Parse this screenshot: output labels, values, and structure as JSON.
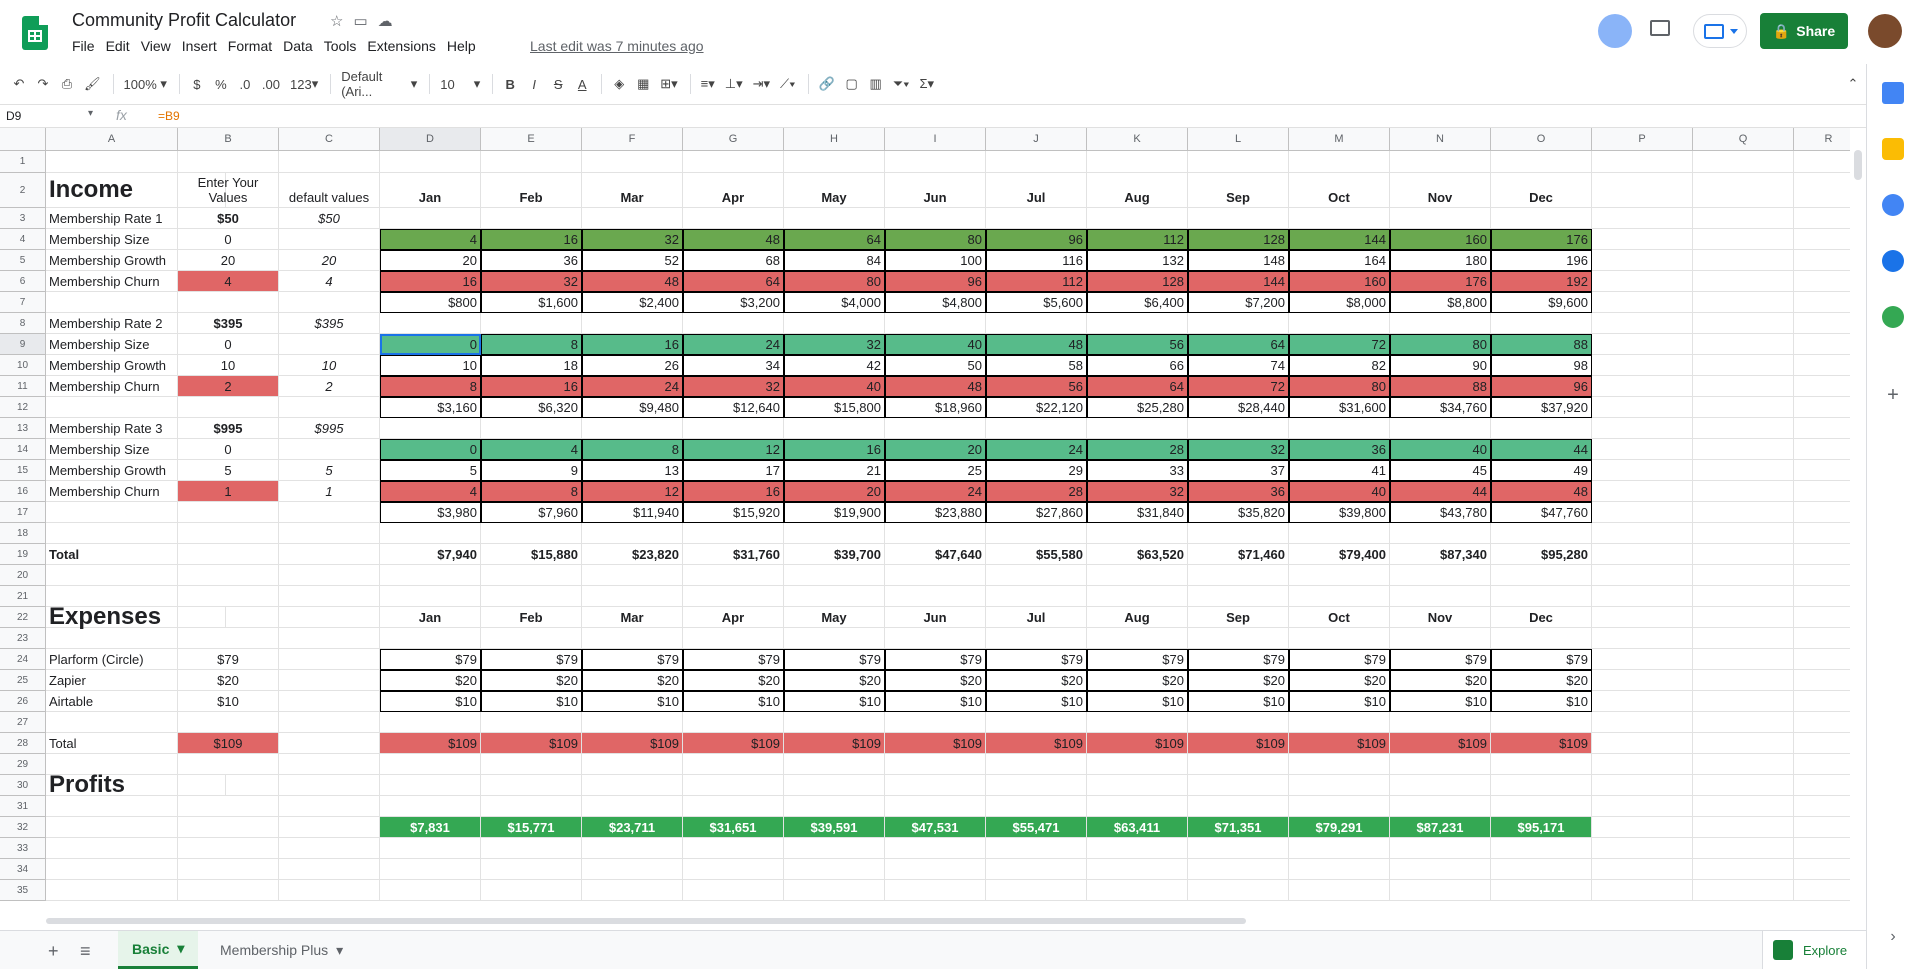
{
  "doc": {
    "title": "Community Profit Calculator",
    "last_edit": "Last edit was 7 minutes ago",
    "share": "Share"
  },
  "menu": [
    "File",
    "Edit",
    "View",
    "Insert",
    "Format",
    "Data",
    "Tools",
    "Extensions",
    "Help"
  ],
  "toolbar": {
    "zoom": "100%",
    "currency": "$",
    "percent": "%",
    "dec_less": ".0",
    "dec_more": ".00",
    "format": "123",
    "font": "Default (Ari...",
    "size": "10",
    "bold": "B",
    "italic": "I",
    "strike": "S",
    "color": "A"
  },
  "formula": {
    "cell": "D9",
    "fx": "fx",
    "value": "=B9"
  },
  "columns": [
    "A",
    "B",
    "C",
    "D",
    "E",
    "F",
    "G",
    "H",
    "I",
    "J",
    "K",
    "L",
    "M",
    "N",
    "O",
    "P",
    "Q",
    "R"
  ],
  "rows": [
    "1",
    "2",
    "3",
    "4",
    "5",
    "6",
    "7",
    "8",
    "9",
    "10",
    "11",
    "12",
    "13",
    "14",
    "15",
    "16",
    "17",
    "18",
    "19",
    "20",
    "21",
    "22",
    "23",
    "24",
    "25",
    "26",
    "27",
    "28",
    "29",
    "30",
    "31",
    "32",
    "33",
    "34",
    "35"
  ],
  "labels": {
    "income": "Income",
    "enter": "Enter Your Values",
    "default": "default values",
    "expenses": "Expenses",
    "profits": "Profits",
    "total": "Total",
    "rate1": "Membership Rate 1",
    "rate2": "Membership Rate 2",
    "rate3": "Membership Rate 3",
    "size": "Membership Size",
    "growth": "Membership Growth",
    "churn": "Membership Churn",
    "plat": "Plarform (Circle)",
    "zapier": "Zapier",
    "airtable": "Airtable"
  },
  "months": [
    "Jan",
    "Feb",
    "Mar",
    "Apr",
    "May",
    "Jun",
    "Jul",
    "Aug",
    "Sep",
    "Oct",
    "Nov",
    "Dec"
  ],
  "inputs": {
    "r1": {
      "rate": "$50",
      "rate_d": "$50",
      "size": "0",
      "growth": "20",
      "growth_d": "20",
      "churn": "4",
      "churn_d": "4"
    },
    "r2": {
      "rate": "$395",
      "rate_d": "$395",
      "size": "0",
      "growth": "10",
      "growth_d": "10",
      "churn": "2",
      "churn_d": "2"
    },
    "r3": {
      "rate": "$995",
      "rate_d": "$995",
      "size": "0",
      "growth": "5",
      "growth_d": "5",
      "churn": "1",
      "churn_d": "1"
    }
  },
  "grid": {
    "r4": [
      "4",
      "16",
      "32",
      "48",
      "64",
      "80",
      "96",
      "112",
      "128",
      "144",
      "160",
      "176"
    ],
    "r5": [
      "20",
      "36",
      "52",
      "68",
      "84",
      "100",
      "116",
      "132",
      "148",
      "164",
      "180",
      "196"
    ],
    "r6": [
      "16",
      "32",
      "48",
      "64",
      "80",
      "96",
      "112",
      "128",
      "144",
      "160",
      "176",
      "192"
    ],
    "r7": [
      "$800",
      "$1,600",
      "$2,400",
      "$3,200",
      "$4,000",
      "$4,800",
      "$5,600",
      "$6,400",
      "$7,200",
      "$8,000",
      "$8,800",
      "$9,600"
    ],
    "r9": [
      "0",
      "8",
      "16",
      "24",
      "32",
      "40",
      "48",
      "56",
      "64",
      "72",
      "80",
      "88"
    ],
    "r10": [
      "10",
      "18",
      "26",
      "34",
      "42",
      "50",
      "58",
      "66",
      "74",
      "82",
      "90",
      "98"
    ],
    "r11": [
      "8",
      "16",
      "24",
      "32",
      "40",
      "48",
      "56",
      "64",
      "72",
      "80",
      "88",
      "96"
    ],
    "r12": [
      "$3,160",
      "$6,320",
      "$9,480",
      "$12,640",
      "$15,800",
      "$18,960",
      "$22,120",
      "$25,280",
      "$28,440",
      "$31,600",
      "$34,760",
      "$37,920"
    ],
    "r14": [
      "0",
      "4",
      "8",
      "12",
      "16",
      "20",
      "24",
      "28",
      "32",
      "36",
      "40",
      "44"
    ],
    "r15": [
      "5",
      "9",
      "13",
      "17",
      "21",
      "25",
      "29",
      "33",
      "37",
      "41",
      "45",
      "49"
    ],
    "r16": [
      "4",
      "8",
      "12",
      "16",
      "20",
      "24",
      "28",
      "32",
      "36",
      "40",
      "44",
      "48"
    ],
    "r17": [
      "$3,980",
      "$7,960",
      "$11,940",
      "$15,920",
      "$19,900",
      "$23,880",
      "$27,860",
      "$31,840",
      "$35,820",
      "$39,800",
      "$43,780",
      "$47,760"
    ],
    "r19": [
      "$7,940",
      "$15,880",
      "$23,820",
      "$31,760",
      "$39,700",
      "$47,640",
      "$55,580",
      "$63,520",
      "$71,460",
      "$79,400",
      "$87,340",
      "$95,280"
    ],
    "r24": [
      "$79",
      "$79",
      "$79",
      "$79",
      "$79",
      "$79",
      "$79",
      "$79",
      "$79",
      "$79",
      "$79",
      "$79"
    ],
    "r25": [
      "$20",
      "$20",
      "$20",
      "$20",
      "$20",
      "$20",
      "$20",
      "$20",
      "$20",
      "$20",
      "$20",
      "$20"
    ],
    "r26": [
      "$10",
      "$10",
      "$10",
      "$10",
      "$10",
      "$10",
      "$10",
      "$10",
      "$10",
      "$10",
      "$10",
      "$10"
    ],
    "r28": [
      "$109",
      "$109",
      "$109",
      "$109",
      "$109",
      "$109",
      "$109",
      "$109",
      "$109",
      "$109",
      "$109",
      "$109"
    ],
    "r32": [
      "$7,831",
      "$15,771",
      "$23,711",
      "$31,651",
      "$39,591",
      "$47,531",
      "$55,471",
      "$63,411",
      "$71,351",
      "$79,291",
      "$87,231",
      "$95,171"
    ]
  },
  "expense_inputs": {
    "plat": "$79",
    "zapier": "$20",
    "airtable": "$10",
    "total": "$109"
  },
  "sheets": [
    {
      "label": "Basic",
      "active": true
    },
    {
      "label": "Membership Plus",
      "active": false
    }
  ],
  "explore": "Explore",
  "colors": {
    "green_dark": "#6aa84f",
    "green_light": "#57bb8a",
    "red": "#e06666",
    "green_profit": "#34a853",
    "share": "#188038"
  }
}
